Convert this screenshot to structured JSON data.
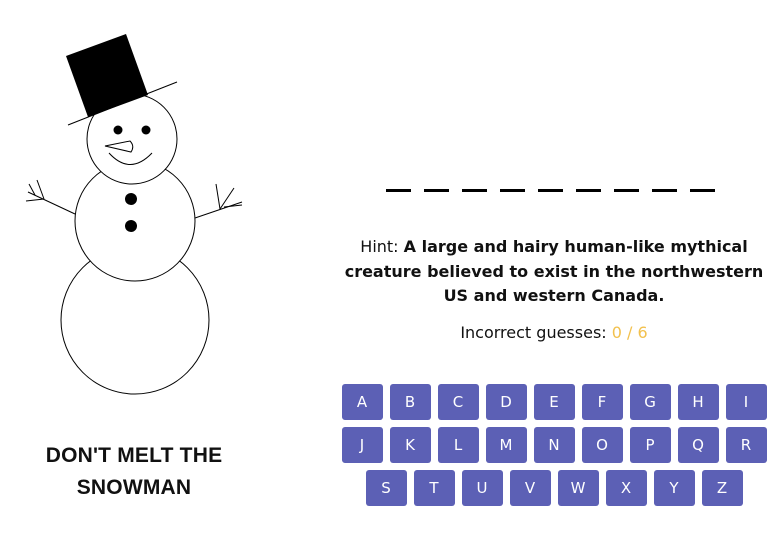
{
  "game": {
    "title": "DON'T MELT THE SNOWMAN",
    "word_length": 9,
    "hint_label": "Hint:",
    "hint_text": "A large and hairy human-like mythical creature believed to exist in the northwestern US and western Canada.",
    "guesses_label": "Incorrect guesses:",
    "guesses_count": "0 / 6",
    "max_incorrect": 6,
    "incorrect": 0
  },
  "keyboard": {
    "letters": [
      "A",
      "B",
      "C",
      "D",
      "E",
      "F",
      "G",
      "H",
      "I",
      "J",
      "K",
      "L",
      "M",
      "N",
      "O",
      "P",
      "Q",
      "R",
      "S",
      "T",
      "U",
      "V",
      "W",
      "X",
      "Y",
      "Z"
    ]
  },
  "colors": {
    "key_background": "#5c60b5",
    "key_text": "#ffffff",
    "count_text": "#f2c14e",
    "outline": "#000000"
  },
  "snowman": {
    "parts": [
      "top-hat",
      "head",
      "eyes",
      "carrot-nose",
      "smile",
      "body",
      "buttons",
      "left-arm",
      "right-arm",
      "base"
    ]
  }
}
